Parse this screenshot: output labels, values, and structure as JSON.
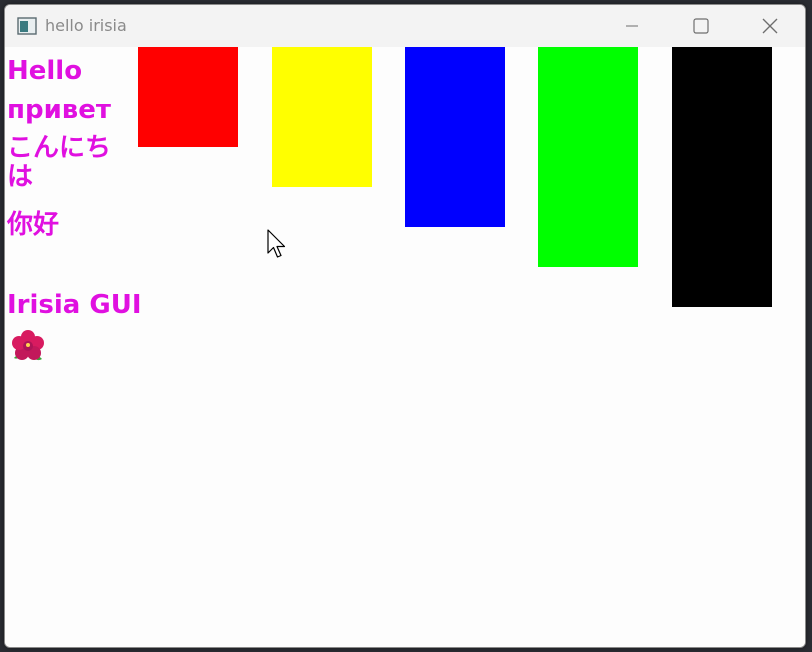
{
  "window": {
    "title": "hello irisia"
  },
  "titlebar_icons": {
    "app": "app-icon",
    "minimize": "minimize-icon",
    "maximize": "maximize-icon",
    "close": "close-icon"
  },
  "content": {
    "greetings": [
      "Hello",
      "привет",
      "こんにちは",
      "你好"
    ],
    "app_name": "Irisia GUI",
    "emoji": "hibiscus-flower-icon",
    "text_color": "#e010e0",
    "rects": [
      {
        "color": "#ff0000",
        "name": "red"
      },
      {
        "color": "#ffff00",
        "name": "yellow"
      },
      {
        "color": "#0000ff",
        "name": "blue"
      },
      {
        "color": "#00ff00",
        "name": "green"
      },
      {
        "color": "#000000",
        "name": "black"
      }
    ]
  }
}
